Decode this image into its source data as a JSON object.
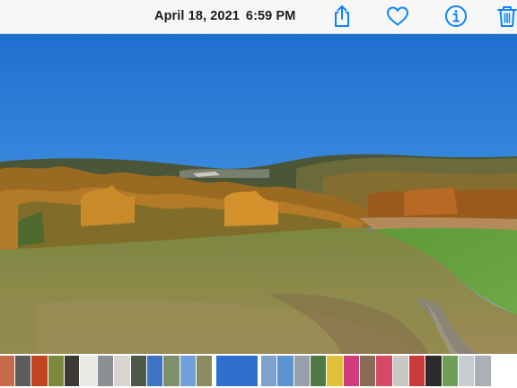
{
  "header": {
    "date": "April 18, 2021",
    "time": "6:59 PM"
  },
  "toolbar": {
    "actions": [
      {
        "name": "share",
        "icon": "share-icon"
      },
      {
        "name": "favorite",
        "icon": "heart-icon"
      },
      {
        "name": "info",
        "icon": "info-icon"
      },
      {
        "name": "delete",
        "icon": "trash-icon"
      }
    ],
    "accent_color": "#0a84ff"
  },
  "photo": {
    "subject": "autumn hillside meadow landscape under clear blue sky"
  },
  "filmstrip": {
    "thumbnails": [
      {
        "color": "#c96b4a"
      },
      {
        "color": "#5c5c5c"
      },
      {
        "color": "#c2451f"
      },
      {
        "color": "#7a8a3a"
      },
      {
        "color": "#3d3a33"
      },
      {
        "color": "#e8e8e4"
      },
      {
        "color": "#8b8f96"
      },
      {
        "color": "#d9d6cf"
      },
      {
        "color": "#4d5a48"
      },
      {
        "color": "#3e73c4"
      },
      {
        "color": "#7f8f6a"
      },
      {
        "color": "#6fa0d8"
      },
      {
        "color": "#8a8c5e"
      },
      {
        "color": "#2e6fd0",
        "current": true
      },
      {
        "color": "#7ea3cf"
      },
      {
        "color": "#5f93cf"
      },
      {
        "color": "#97a0a8"
      },
      {
        "color": "#4f7a45"
      },
      {
        "color": "#e0c23a"
      },
      {
        "color": "#d23c7a"
      },
      {
        "color": "#8c6b54"
      },
      {
        "color": "#d84a64"
      },
      {
        "color": "#c8c8c4"
      },
      {
        "color": "#cc3b3b"
      },
      {
        "color": "#2b2b2b"
      },
      {
        "color": "#6f9e58"
      },
      {
        "color": "#c7ccd2"
      },
      {
        "color": "#a9b0b8"
      }
    ]
  }
}
